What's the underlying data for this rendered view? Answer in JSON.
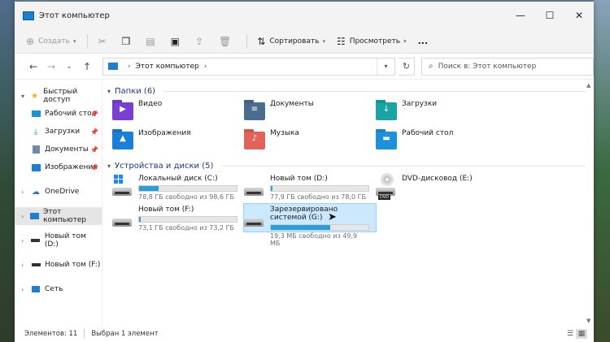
{
  "window": {
    "title": "Этот компьютер"
  },
  "toolbar": {
    "create": "Создать",
    "sort": "Сортировать",
    "view": "Просмотреть",
    "more": "..."
  },
  "address": {
    "path": "Этот компьютер",
    "search_placeholder": "Поиск в: Этот компьютер"
  },
  "sidebar": {
    "items": [
      {
        "label": "Быстрый доступ",
        "icon": "star-icon",
        "expand": "▾"
      },
      {
        "label": "Рабочий стол",
        "icon": "desktop-icon",
        "pin": true
      },
      {
        "label": "Загрузки",
        "icon": "download-icon",
        "pin": true
      },
      {
        "label": "Документы",
        "icon": "documents-icon",
        "pin": true
      },
      {
        "label": "Изображения",
        "icon": "pictures-icon",
        "pin": true
      },
      {
        "label": "OneDrive",
        "icon": "cloud-icon",
        "expand": "›"
      },
      {
        "label": "Этот компьютер",
        "icon": "computer-icon",
        "expand": "›",
        "selected": true
      },
      {
        "label": "Новый том (D:)",
        "icon": "drive-icon",
        "expand": "›"
      },
      {
        "label": "Новый том (F:)",
        "icon": "drive-icon",
        "expand": "›"
      },
      {
        "label": "Сеть",
        "icon": "network-icon",
        "expand": "›"
      }
    ]
  },
  "folders_group": {
    "title": "Папки (6)",
    "items": [
      {
        "label": "Видео",
        "icon": "video-folder-icon",
        "color": "#7a3fd1"
      },
      {
        "label": "Документы",
        "icon": "documents-folder-icon",
        "color": "#4a6d8f"
      },
      {
        "label": "Загрузки",
        "icon": "downloads-folder-icon",
        "color": "#1aa3a3"
      },
      {
        "label": "Изображения",
        "icon": "pictures-folder-icon",
        "color": "#1a7fd6"
      },
      {
        "label": "Музыка",
        "icon": "music-folder-icon",
        "color": "#e2635a"
      },
      {
        "label": "Рабочий стол",
        "icon": "desktop-folder-icon",
        "color": "#1b92d9"
      }
    ]
  },
  "drives_group": {
    "title": "Устройства и диски (5)",
    "items": [
      {
        "label": "Локальный диск (C:)",
        "free": "78,8 ГБ свободно из 98,6 ГБ",
        "used_fraction": 0.2,
        "kind": "system"
      },
      {
        "label": "Новый том (D:)",
        "free": "77,9 ГБ свободно из 78,0 ГБ",
        "used_fraction": 0.01,
        "kind": "disk"
      },
      {
        "label": "DVD-дисковод (E:)",
        "free": "",
        "used_fraction": null,
        "kind": "dvd",
        "badge": "DVD"
      },
      {
        "label": "Новый том (F:)",
        "free": "73,1 ГБ свободно из 73,2 ГБ",
        "used_fraction": 0.01,
        "kind": "disk"
      },
      {
        "label": "Зарезервировано системой (G:)",
        "free": "19,3 МБ свободно из 49,9 МБ",
        "used_fraction": 0.61,
        "kind": "disk",
        "selected": true
      }
    ]
  },
  "status": {
    "items_count": "Элементов: 11",
    "selected": "Выбран 1 элемент"
  }
}
